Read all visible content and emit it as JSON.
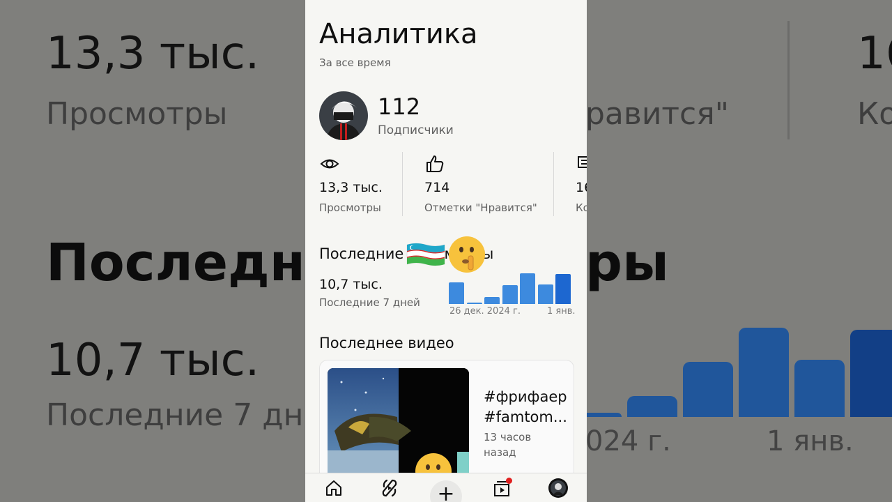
{
  "page": {
    "title": "Аналитика",
    "period": "За все время"
  },
  "channel": {
    "subscribers": "112",
    "subscribers_label": "Подписчики"
  },
  "stats": [
    {
      "icon": "eye-icon",
      "value": "13,3 тыс.",
      "label": "Просмотры"
    },
    {
      "icon": "thumbs-up-icon",
      "value": "714",
      "label": "Отметки \"Нравится\""
    },
    {
      "icon": "comment-icon",
      "value": "16",
      "label": "Ко"
    }
  ],
  "recent": {
    "heading": "Последние просмотры",
    "value": "10,7 тыс.",
    "label": "Последние 7 дней",
    "date_start": "26 дек. 2024 г.",
    "date_end": "1 янв."
  },
  "chart_data": {
    "type": "bar",
    "categories": [
      "26 дек. 2024 г.",
      "",
      "",
      "",
      "",
      "",
      "1 янв."
    ],
    "values": [
      30,
      1,
      10,
      26,
      42,
      27,
      41
    ],
    "colors": {
      "bar": "#3d8ade",
      "last_bar": "#1d67d0"
    }
  },
  "latest_video": {
    "heading": "Последнее видео",
    "title_line1": "#фрифаер",
    "title_line2": "#famtom...",
    "time_line1": "13 часов",
    "time_line2": "назад"
  },
  "background_mirror": {
    "num1": "13,3 тыс.",
    "lab1": "Просмотры",
    "lab2": "равится\"",
    "num3": "16",
    "lab3": "Ко",
    "head": "Последние",
    "head2": "ры",
    "val": "10,7 тыс.",
    "sub": "Последние 7 дн",
    "date1": "024 г.",
    "date2": "1 янв."
  },
  "nav": [
    "home-icon",
    "shorts-icon",
    "create-icon",
    "subscriptions-icon",
    "profile-icon"
  ],
  "overlays": [
    "flag-uzbekistan",
    "shushing-face-emoji"
  ]
}
